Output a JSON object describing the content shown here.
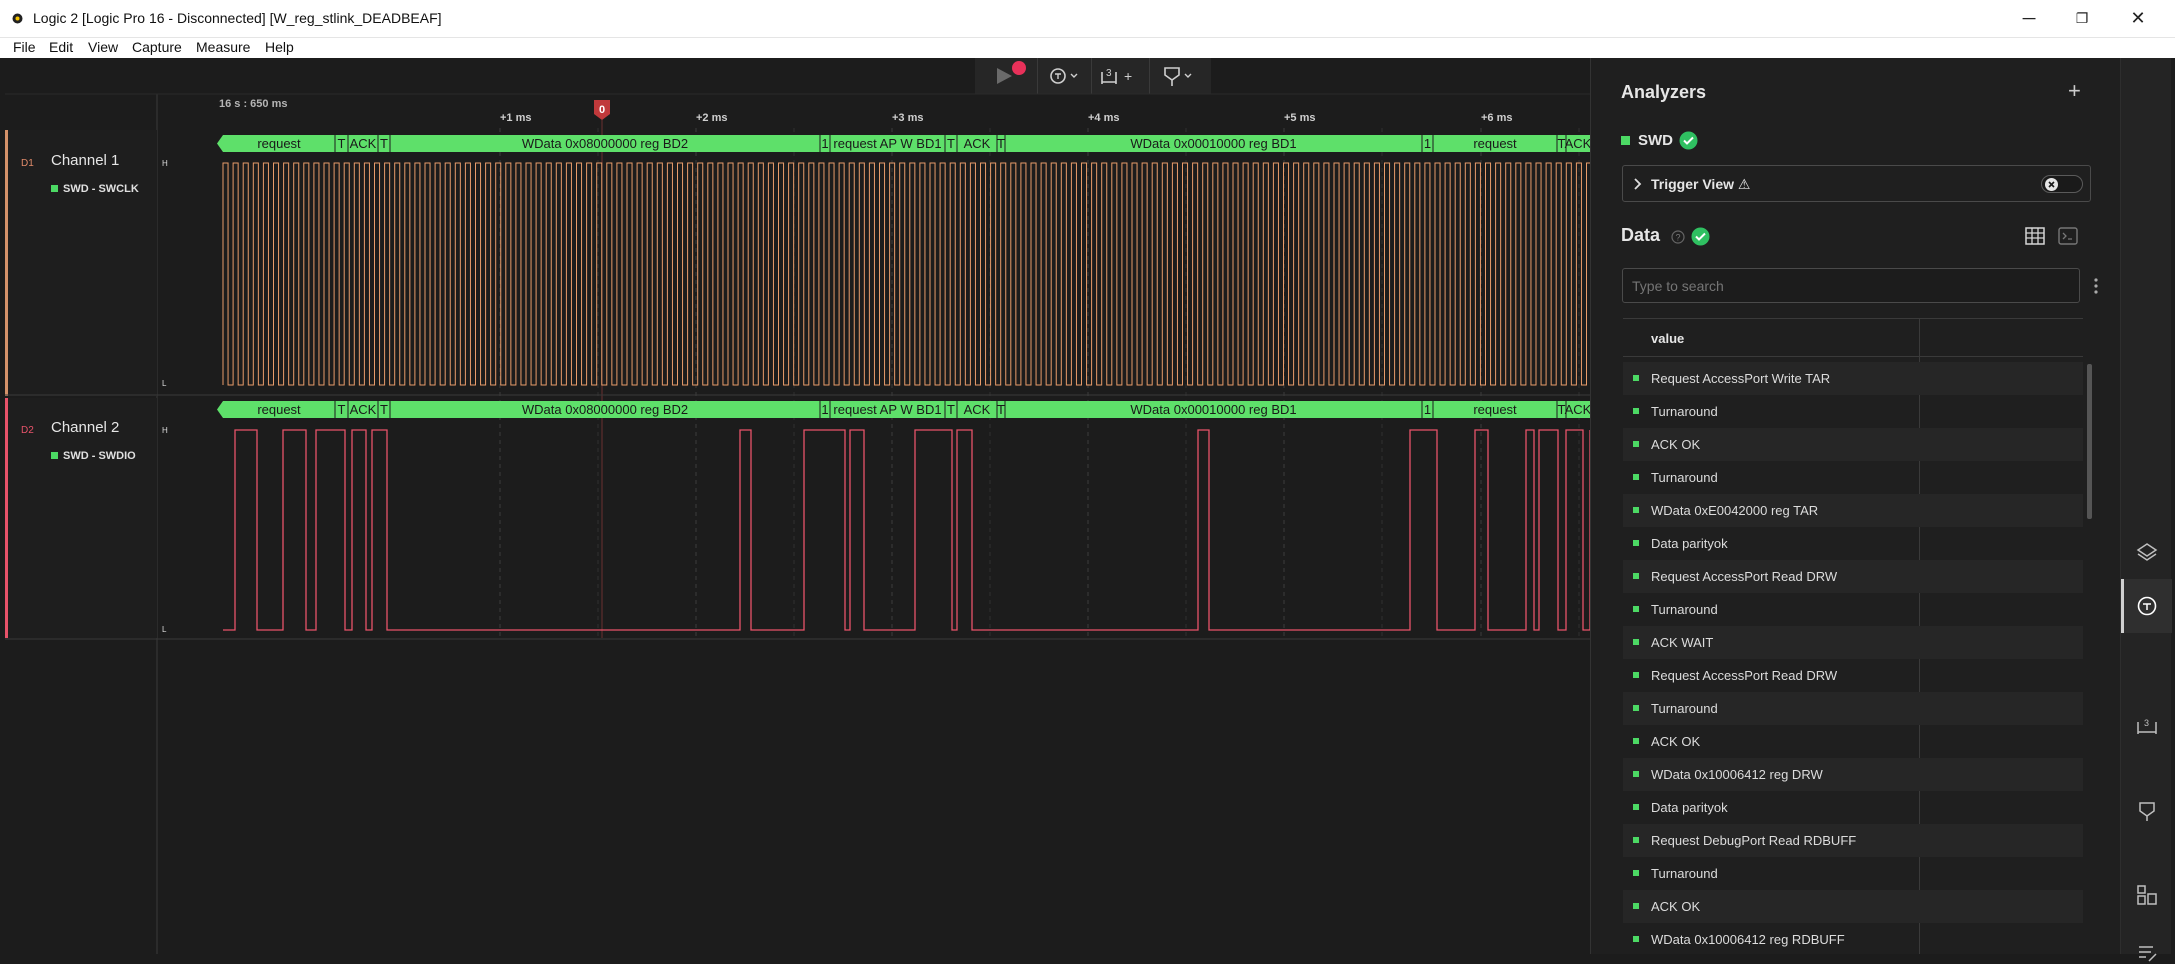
{
  "window": {
    "title": "Logic 2 [Logic Pro 16 - Disconnected] [W_reg_stlink_DEADBEAF]",
    "controls": [
      "─",
      "❐",
      "✕"
    ]
  },
  "menu": [
    "File",
    "Edit",
    "View",
    "Capture",
    "Measure",
    "Help"
  ],
  "toolbar": {
    "trigger_count": "3",
    "plus": "+"
  },
  "ruler": {
    "start_label": "16 s : 650 ms",
    "ticks": [
      "+1 ms",
      "+2 ms",
      "+3 ms",
      "+4 ms",
      "+5 ms",
      "+6 ms"
    ],
    "marker_label": "0"
  },
  "channels": [
    {
      "id": "D1",
      "name": "Channel 1",
      "signal": "SWD - SWCLK",
      "color": "#e89c6a",
      "high": "H",
      "low": "L"
    },
    {
      "id": "D2",
      "name": "Channel 2",
      "signal": "SWD - SWDIO",
      "color": "#e8536a",
      "high": "H",
      "low": "L"
    }
  ],
  "decoder_segments": [
    "request",
    "T",
    "ACK",
    "T",
    "WData 0x08000000 reg BD2",
    "1",
    "request AP W BD1",
    "T",
    "ACK",
    "T",
    "WData 0x00010000 reg BD1",
    "1",
    "request",
    "T",
    "ACK"
  ],
  "analyzers": {
    "title": "Analyzers",
    "add": "+",
    "swd_label": "SWD",
    "trigger_view": "Trigger View ⚠"
  },
  "data_panel": {
    "title": "Data",
    "search_placeholder": "Type to search",
    "column": "value",
    "rows": [
      "Request AccessPort Write TAR",
      "Turnaround",
      "ACK OK",
      "Turnaround",
      "WData 0xE0042000 reg TAR",
      "Data parityok",
      "Request AccessPort Read DRW",
      "Turnaround",
      "ACK WAIT",
      "Request AccessPort Read DRW",
      "Turnaround",
      "ACK OK",
      "WData 0x10006412 reg DRW",
      "Data parityok",
      "Request DebugPort Read RDBUFF",
      "Turnaround",
      "ACK OK",
      "WData 0x10006412 reg RDBUFF"
    ]
  },
  "colors": {
    "accent_green": "#4cd964",
    "decoder_green": "#5ee06a",
    "clock_trace": "#e89c6a",
    "data_trace": "#e8536a",
    "marker": "#c0393b"
  }
}
